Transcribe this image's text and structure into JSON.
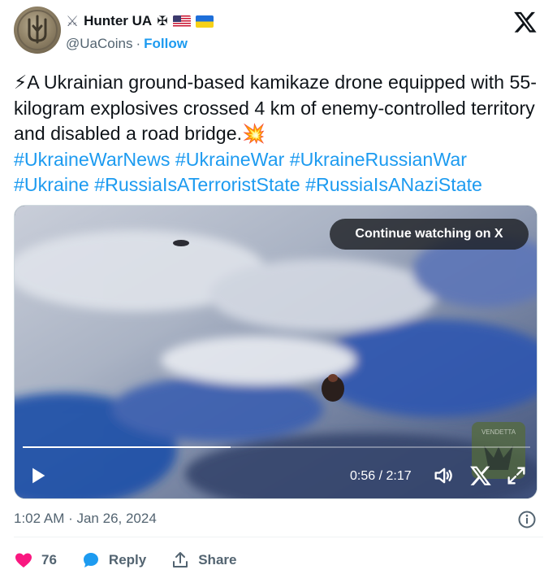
{
  "author": {
    "display_name": "Hunter UA",
    "handle": "@UaCoins",
    "separator": "·",
    "follow_label": "Follow"
  },
  "tweet": {
    "emoji_start": "⚡",
    "text": "A Ukrainian ground-based kamikaze drone equipped with 55-kilogram explosives crossed 4 km of enemy-controlled territory and disabled a road bridge.",
    "emoji_end": "💥",
    "hashtags": [
      "#UkraineWarNews",
      "#UkraineWar",
      "#UkraineRussianWar",
      "#Ukraine",
      "#RussiaIsATerroristState",
      "#RussiaIsANaziState"
    ]
  },
  "video": {
    "continue_label": "Continue watching on X",
    "current_time": "0:56",
    "duration": "2:17",
    "progress_fraction": 0.41,
    "watermark_text": "VENDETTA"
  },
  "meta": {
    "timestamp": "1:02 AM · Jan 26, 2024"
  },
  "actions": {
    "like_count": "76",
    "reply_label": "Reply",
    "share_label": "Share"
  },
  "colors": {
    "accent": "#1d9bf0",
    "like": "#f91880",
    "muted": "#536471"
  },
  "icons": {
    "verified_swords": "crossed-swords-icon",
    "cross": "iron-cross-icon",
    "flag_us": "us-flag-icon",
    "flag_ua": "ukraine-flag-icon",
    "x_logo": "x-logo-icon",
    "play": "play-icon",
    "volume": "volume-icon",
    "x_small": "x-logo-small-icon",
    "fullscreen": "fullscreen-icon",
    "info": "info-icon",
    "heart": "heart-icon",
    "reply": "reply-bubble-icon",
    "share": "share-icon"
  }
}
